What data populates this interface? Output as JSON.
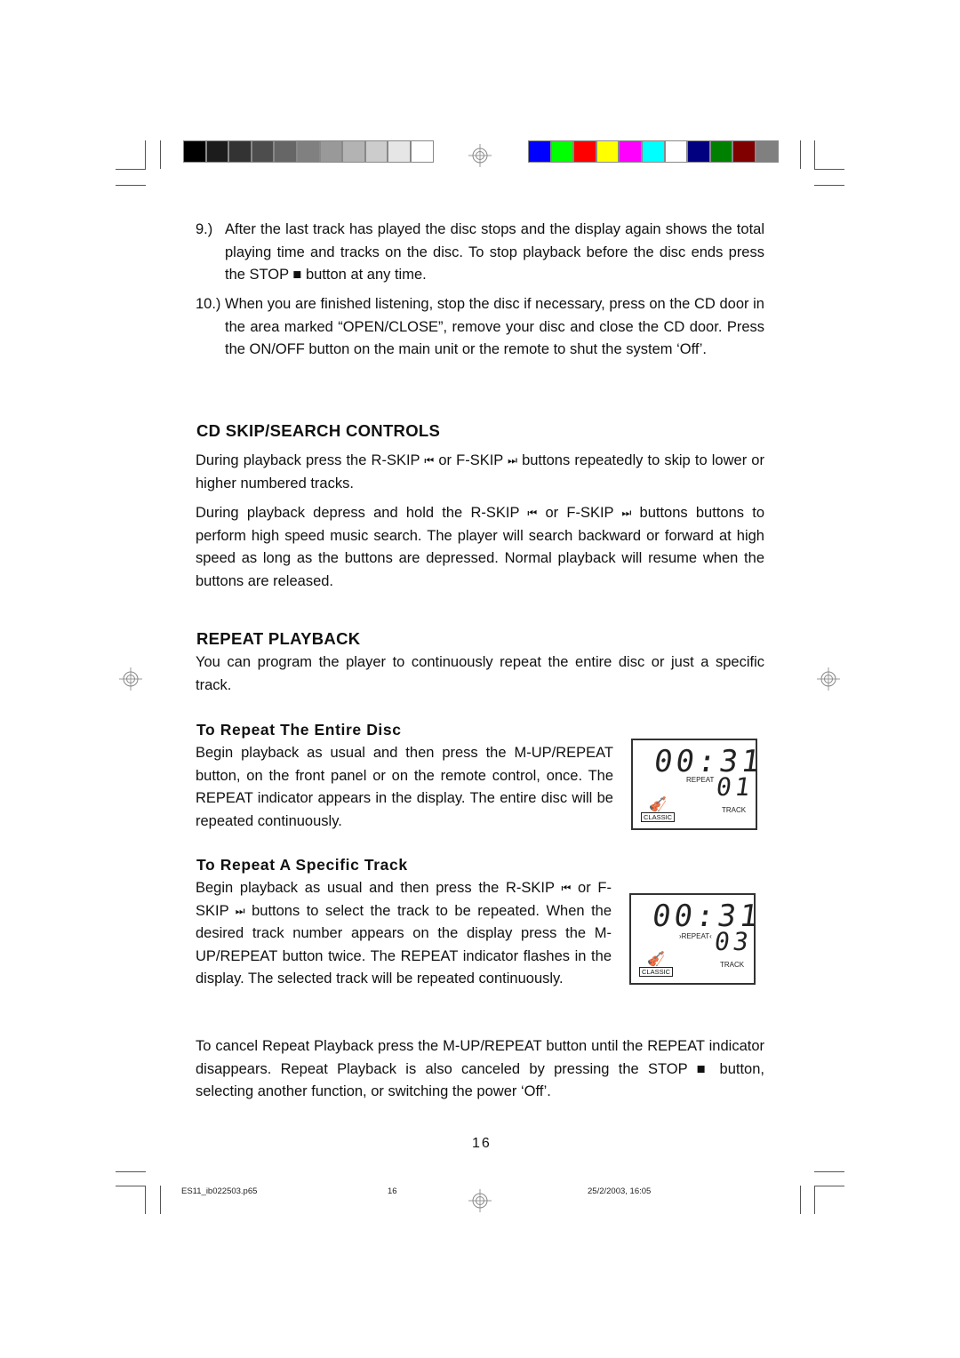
{
  "print_marks": {
    "gray_swatches": [
      "#000000",
      "#1c1c1c",
      "#333333",
      "#4d4d4d",
      "#666666",
      "#808080",
      "#999999",
      "#b3b3b3",
      "#cccccc",
      "#e6e6e6",
      "#ffffff"
    ],
    "color_swatches": [
      "#0000ff",
      "#00ff00",
      "#ff0000",
      "#ffff00",
      "#ff00ff",
      "#00ffff",
      "#ffffff",
      "#000080",
      "#008000",
      "#800000",
      "#808080"
    ]
  },
  "steps": [
    {
      "num": "9.)",
      "text": "After the last track has played the disc stops and the display again shows the total playing time and tracks on the disc. To stop playback before the disc ends press the STOP ■ button at any time."
    },
    {
      "num": "10.)",
      "text": "When you are finished listening, stop the disc if necessary, press on the CD door in the area marked “OPEN/CLOSE”, remove your disc and close the CD door. Press the ON/OFF button on the main unit or the remote to shut the system ‘Off’."
    }
  ],
  "skip_section": {
    "heading": "CD SKIP/SEARCH CONTROLS",
    "p1_a": "During playback press the R-SKIP ",
    "p1_b": " or F-SKIP ",
    "p1_c": " buttons repeatedly to skip to lower or higher numbered tracks.",
    "p2_a": "During playback depress and hold the R-SKIP ",
    "p2_b": " or F-SKIP ",
    "p2_c": " buttons buttons to perform high speed music search. The player will search backward or forward at high speed as long as the buttons are depressed. Normal playback will resume when the buttons are released.",
    "rskip_icon": "⏮",
    "fskip_icon": "⏭"
  },
  "repeat_section": {
    "heading": "REPEAT PLAYBACK",
    "intro": "You can program the player to continuously repeat the entire disc or just a specific track.",
    "entire": {
      "heading": "To Repeat The Entire Disc",
      "text": "Begin playback as usual and then press the M-UP/REPEAT button, on the front panel or on the remote control, once. The REPEAT indicator appears in the display. The entire disc will be repeated continuously."
    },
    "specific": {
      "heading": "To Repeat A Specific Track",
      "text_a": "Begin playback as usual and then press the R-SKIP ",
      "text_b": " or F-SKIP ",
      "text_c": " buttons to select the track to be repeated. When the desired track number appears on the display press the M-UP/REPEAT button twice. The REPEAT indicator flashes in the display. The selected track will be repeated continuously."
    },
    "cancel": "To cancel Repeat Playback press the M-UP/REPEAT button until the REPEAT indicator disappears. Repeat Playback is also canceled by pressing the STOP ■ button, selecting another function, or switching the power ‘Off’."
  },
  "lcd1": {
    "time": "00:31",
    "track": "01",
    "repeat": "REPEAT",
    "track_label": "TRACK",
    "mode": "CLASSIC"
  },
  "lcd2": {
    "time": "00:31",
    "track": "03",
    "repeat": "REPEAT",
    "track_label": "TRACK",
    "mode": "CLASSIC"
  },
  "page_number": "16",
  "footer": {
    "file": "ES11_ib022503.p65",
    "page": "16",
    "date": "25/2/2003, 16:05"
  }
}
